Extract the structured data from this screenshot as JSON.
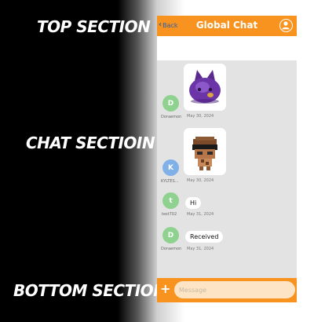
{
  "labels": {
    "top": "TOP SECTION",
    "chat": "CHAT SECTIOIN",
    "bottom": "BOTTOM SECTION"
  },
  "header": {
    "back_label": "Back",
    "back_icon": "chevron-left-icon",
    "title": "Global Chat",
    "profile_icon": "user-circle-icon",
    "bg_color": "#f7931e",
    "title_color": "#ffffff",
    "back_color": "#2d5fa8"
  },
  "messages": [
    {
      "initial": "D",
      "username": "Doraemon",
      "date": "May 30, 2024",
      "type": "image",
      "image": "purple-cat-creature",
      "avatar_color": "#8fd18f"
    },
    {
      "initial": "K",
      "username": "KYLTES...",
      "date": "May 30, 2024",
      "type": "image",
      "image": "sunglasses-block-character",
      "avatar_color": "#7fb1e8"
    },
    {
      "initial": "t",
      "username": "test702",
      "date": "May 31, 2024",
      "type": "text",
      "text": "Hi",
      "avatar_color": "#8fd18f"
    },
    {
      "initial": "D",
      "username": "Doraemon",
      "date": "May 31, 2024",
      "type": "text",
      "text": "Received",
      "avatar_color": "#8fd18f"
    }
  ],
  "bottom": {
    "add_icon": "plus-icon",
    "placeholder": "Message",
    "bg_color": "#f7931e"
  }
}
